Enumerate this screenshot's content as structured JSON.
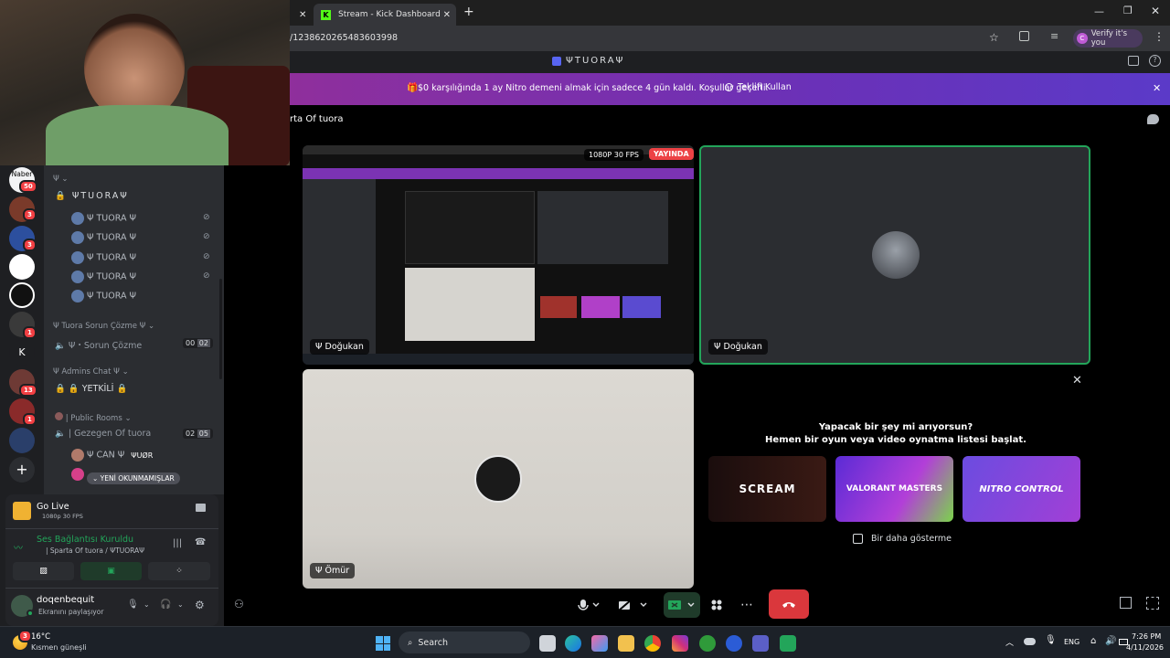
{
  "browser": {
    "tab_partial_label": "",
    "tab_kick_label": "Stream - Kick Dashboard",
    "url": "/1238620265483603998",
    "profile_label": "Verify it's you",
    "profile_initial": "C"
  },
  "discord": {
    "server_title": "ΨTUORAΨ",
    "promo_text": "$0 karşılığında 1 ay Nitro demeni almak için sadece 4 gün kaldı. Koşullar geçerli.",
    "promo_button": "Teklifi Kullan",
    "channel_header": "rta Of tuora",
    "rail": {
      "top_label": "Naber",
      "top_badge": "50",
      "badges": [
        "3",
        "3",
        "1",
        "13",
        "1"
      ],
      "letter": "K"
    },
    "channels": {
      "top_cat": "Ψ",
      "server_name": "ΨTUORAΨ",
      "voice_users": [
        "Ψ TUORA Ψ",
        "Ψ TUORA Ψ",
        "Ψ TUORA Ψ",
        "Ψ TUORA Ψ",
        "Ψ TUORA Ψ"
      ],
      "cat_sorun": "Ψ Tuora Sorun Çözme Ψ",
      "ch_sorun": "Ψ・Sorun Çözme",
      "ch_sorun_count_a": "00",
      "ch_sorun_count_b": "02",
      "cat_admins": "Ψ Admins Chat Ψ",
      "ch_yetkili": "🔒 YETKİLİ 🔒",
      "cat_public": "| Public Rooms",
      "ch_gezegen": "| Gezegen Of tuora",
      "ch_gezegen_count_a": "02",
      "ch_gezegen_count_b": "05",
      "user_can": "Ψ CAN Ψ",
      "user_tuor": "ΨUØR",
      "unread_pill": "YENİ OKUNMAMIŞLAR"
    },
    "panel": {
      "golive_title": "Go Live",
      "golive_sub": "1080p 30 FPS",
      "voice_status": "Ses Bağlantısı Kuruldu",
      "voice_channel": "| Sparta Of tuora / ΨTUORAΨ",
      "username": "doqenbequit",
      "user_status": "Ekranını paylaşıyor"
    },
    "stream": {
      "quality": "1080P 30 FPS",
      "live_badge": "YAYINDA",
      "tile1_user": "Ψ Doğukan",
      "tile2_user": "Ψ Doğukan",
      "tile3_user": "Ψ Ömür"
    },
    "activity": {
      "title_line1": "Yapacak bir şey mi arıyorsun?",
      "title_line2": "Hemen bir oyun veya video oynatma listesi başlat.",
      "dont_show": "Bir daha gösterme",
      "cards": [
        "SCREAM",
        "VALORANT MASTERS",
        "NITRO CONTROL"
      ]
    }
  },
  "taskbar": {
    "weather_temp": "16°C",
    "weather_desc": "Kısmen güneşli",
    "weather_badge": "3",
    "search_label": "Search",
    "lang": "ENG",
    "time": "7:26 PM",
    "date": "4/11/2026"
  },
  "colors": {
    "accent_green": "#23a55a",
    "live_red": "#ed4245",
    "promo_purple": "#7b33b3",
    "hangup_red": "#da373c"
  }
}
